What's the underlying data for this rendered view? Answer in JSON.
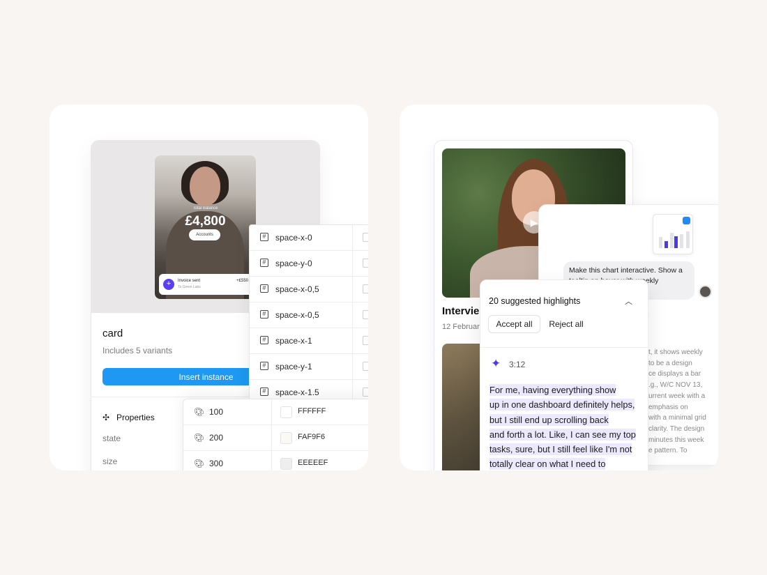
{
  "left_panel": {
    "preview": {
      "balance_label": "Total Balance",
      "balance_amount": "£4,800",
      "accounts_button": "Accounts",
      "notification": {
        "title": "Invoice sent",
        "subtitle": "To Green Labs",
        "amount": "+£550"
      }
    },
    "component": {
      "title": "card",
      "subtitle": "Includes 5 variants",
      "insert_button": "Insert instance",
      "properties_title": "Properties",
      "properties": [
        "state",
        "size"
      ]
    },
    "spacing_tokens": [
      "space-x-0",
      "space-y-0",
      "space-x-0,5",
      "space-x-0,5",
      "space-x-1",
      "space-y-1",
      "space-x-1.5"
    ],
    "color_tokens": [
      {
        "name": "100",
        "hex": "FFFFFF",
        "color": "#FFFFFF"
      },
      {
        "name": "200",
        "hex": "FAF9F6",
        "color": "#FAF9F6"
      },
      {
        "name": "300",
        "hex": "EEEEEF",
        "color": "#EEEEEF"
      }
    ]
  },
  "right_panel": {
    "video": {
      "title": "Intervie",
      "date": "12 February"
    },
    "chat": {
      "message": "Make this chart interactive. Show a tooltip on hover with weekly",
      "fragment": ":",
      "response_lines": [
        "t, it shows weekly",
        "to be a design",
        "ce displays a bar",
        ".g., W/C NOV 13,",
        "urrent week with a",
        "emphasis on",
        "with a minimal grid",
        "clarity. The design",
        "minutes this week",
        "e pattern. To"
      ]
    },
    "highlights": {
      "title": "20 suggested highlights",
      "accept_all": "Accept all",
      "reject_all": "Reject all",
      "timestamp": "3:12",
      "transcript_lines": [
        "For me, having everything show",
        "up in one dashboard definitely helps,",
        "but I still end up scrolling back",
        "and forth a lot. Like, I can see my top",
        "tasks, sure, but I still feel like I'm not",
        "totally clear on what I need to"
      ]
    }
  },
  "colors": {
    "accent_blue": "#1e98f2",
    "accent_purple": "#4b3ae8",
    "highlight": "#ece8fd"
  }
}
